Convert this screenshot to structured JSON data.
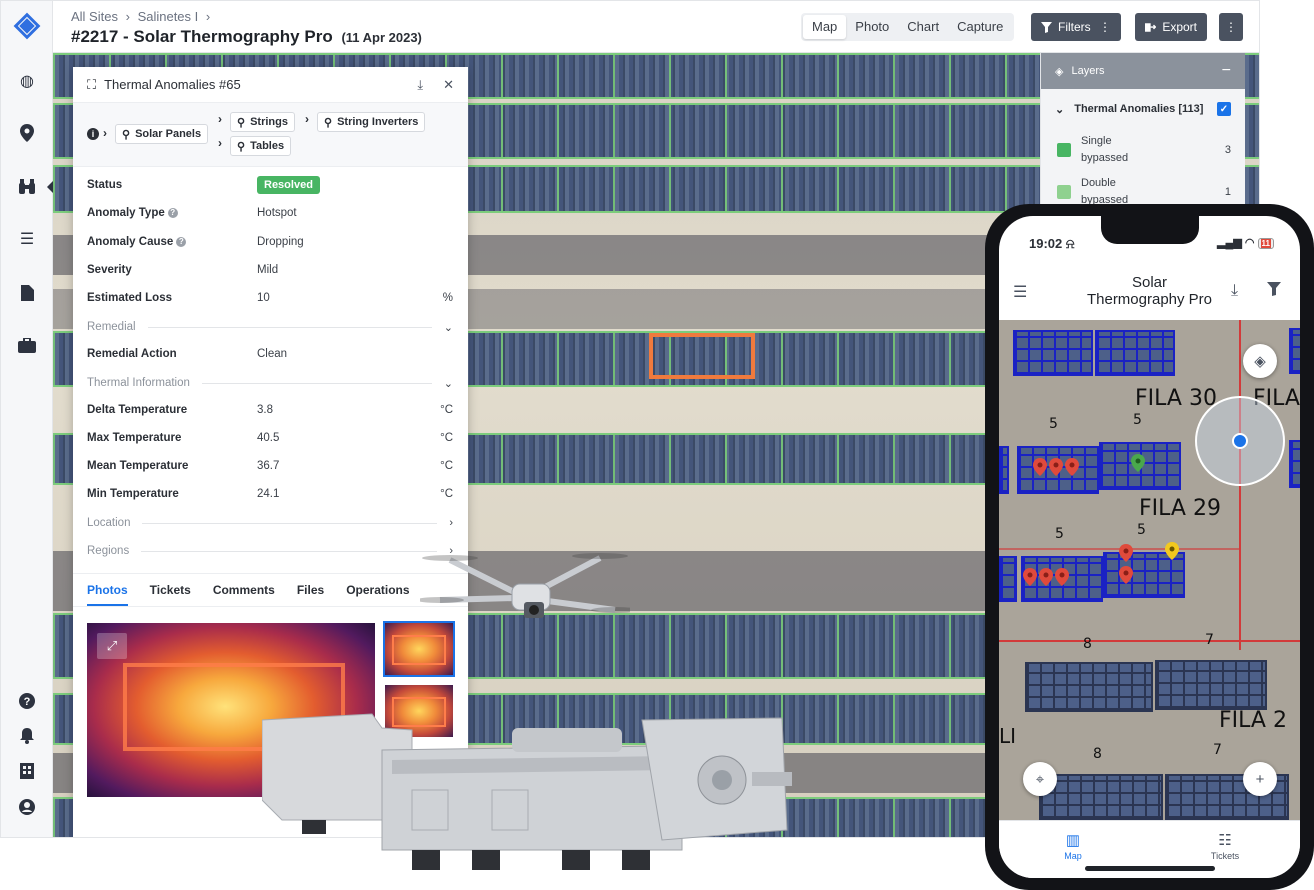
{
  "breadcrumb": {
    "root": "All Sites",
    "site": "Salinetes I"
  },
  "page": {
    "title": "#2217 - Solar Thermography Pro",
    "date": "(11 Apr 2023)"
  },
  "view_tabs": [
    "Map",
    "Photo",
    "Chart",
    "Capture"
  ],
  "active_view": "Map",
  "toolbar": {
    "filters_label": "Filters",
    "export_label": "Export"
  },
  "layers": {
    "title": "Layers",
    "group": "Thermal Anomalies [113]",
    "items": [
      {
        "label": "Single bypassed",
        "count": "3",
        "color": "#48b563"
      },
      {
        "label": "Double bypassed",
        "count": "1",
        "color": "#8fd18f"
      }
    ]
  },
  "detail": {
    "title": "Thermal Anomalies #65",
    "relations": [
      "Solar Panels",
      "Strings",
      "String Inverters",
      "Tables"
    ],
    "status_label": "Status",
    "status_value": "Resolved",
    "anomaly_type_label": "Anomaly Type",
    "anomaly_type_value": "Hotspot",
    "anomaly_cause_label": "Anomaly Cause",
    "anomaly_cause_value": "Dropping",
    "severity_label": "Severity",
    "severity_value": "Mild",
    "estimated_loss_label": "Estimated Loss",
    "estimated_loss_value": "10",
    "estimated_loss_unit": "%",
    "remedial_section": "Remedial",
    "remedial_action_label": "Remedial Action",
    "remedial_action_value": "Clean",
    "thermal_section": "Thermal Information",
    "delta_label": "Delta Temperature",
    "delta_value": "3.8",
    "max_label": "Max Temperature",
    "max_value": "40.5",
    "mean_label": "Mean Temperature",
    "mean_value": "36.7",
    "min_label": "Min Temperature",
    "min_value": "24.1",
    "temp_unit": "°C",
    "location_section": "Location",
    "regions_section": "Regions",
    "tabs": [
      "Photos",
      "Tickets",
      "Comments",
      "Files",
      "Operations"
    ]
  },
  "phone": {
    "time": "19:02",
    "battery": "11",
    "title_line1": "Solar",
    "title_line2": "Thermography Pro",
    "row_labels": [
      "FILA 30",
      "FILA",
      "FILA 29",
      "FILA 2"
    ],
    "numbers": [
      "5",
      "5",
      "5",
      "5",
      "8",
      "7",
      "8",
      "7"
    ],
    "map_label_left": "LI",
    "tabs": [
      "Map",
      "Tickets"
    ]
  },
  "colors": {
    "accent": "#1a73e8",
    "resolved": "#48b563",
    "hotspot": "#f07a3d",
    "pin_red": "#e04a3c",
    "pin_green": "#4aa84c",
    "pin_yellow": "#f2c81f"
  }
}
